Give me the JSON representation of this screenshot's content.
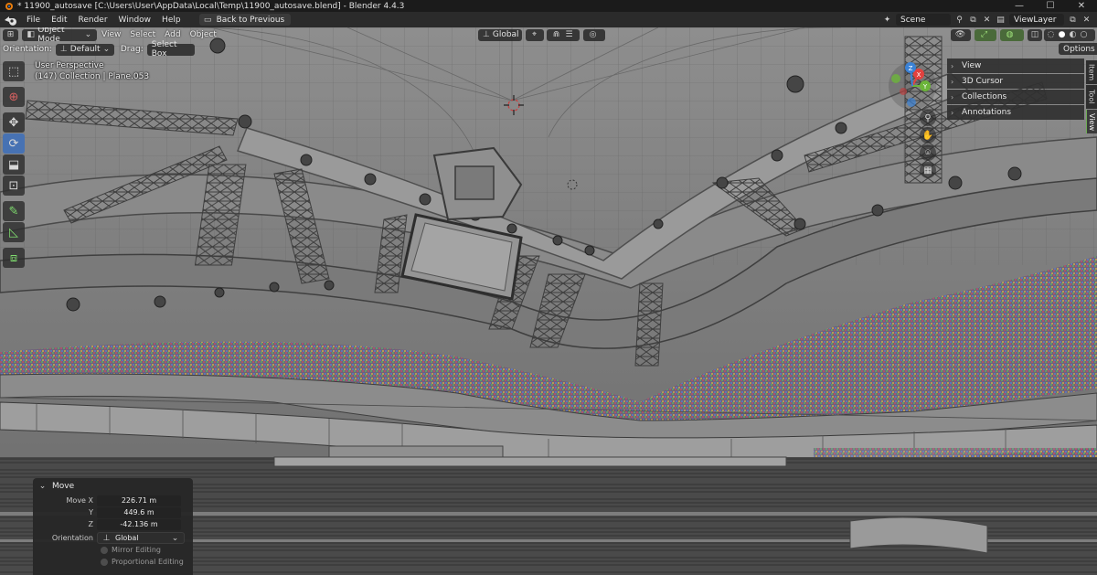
{
  "window": {
    "title": "* 11900_autosave [C:\\Users\\User\\AppData\\Local\\Temp\\11900_autosave.blend] - Blender 4.4.3",
    "minimize": "—",
    "maximize": "☐",
    "close": "✕"
  },
  "menubar": {
    "items": [
      "File",
      "Edit",
      "Render",
      "Window",
      "Help"
    ],
    "back_label": "Back to Previous",
    "scene": "Scene",
    "view_layer": "ViewLayer"
  },
  "viewport_header": {
    "mode": "Object Mode",
    "menus": [
      "View",
      "Select",
      "Add",
      "Object"
    ],
    "transform_orientation": "Global",
    "options_label": "Options"
  },
  "tool_header": {
    "orientation_label": "Orientation:",
    "orientation_value": "Default",
    "drag_label": "Drag:",
    "drag_value": "Select Box"
  },
  "overlay_info": {
    "view_name": "User Perspective",
    "collection_info": "(147) Collection | Plane.053"
  },
  "sidebar": {
    "panels": [
      "View",
      "3D Cursor",
      "Collections",
      "Annotations"
    ],
    "tabs": [
      "Item",
      "Tool",
      "View"
    ],
    "active_tab": "View"
  },
  "operator_panel": {
    "title": "Move",
    "fields": [
      {
        "label": "Move X",
        "value": "226.71 m"
      },
      {
        "label": "Y",
        "value": "449.6 m"
      },
      {
        "label": "Z",
        "value": "-42.136 m"
      }
    ],
    "orientation_label": "Orientation",
    "orientation_value": "Global",
    "checks": [
      "Mirror Editing",
      "Proportional Editing"
    ]
  },
  "gizmo": {
    "x_label": "X",
    "y_label": "Y",
    "z_label": "Z"
  },
  "colors": {
    "accent": "#4772b3",
    "x_axis": "#e2413f",
    "y_axis": "#6cb53a",
    "z_axis": "#3b82d6",
    "active_tool_icon": "#7fdc6e"
  }
}
